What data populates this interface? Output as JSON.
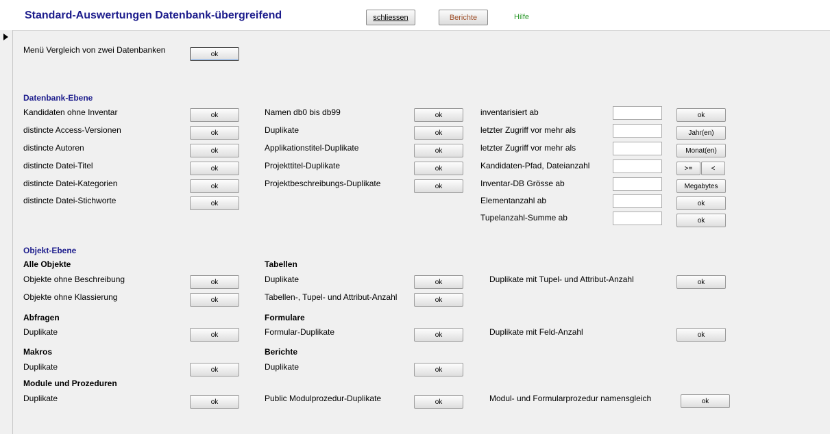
{
  "header": {
    "title": "Standard-Auswertungen Datenbank-übergreifend",
    "close_label": "schliessen",
    "reports_label": "Berichte",
    "help_label": "Hilfe",
    "help_color": "#2e9a2e",
    "reports_color": "#a0522d",
    "title_color": "#1c1c8c"
  },
  "menu_compare": {
    "label": "Menü Vergleich von zwei Datenbanken",
    "button": "ok"
  },
  "db_level": {
    "heading": "Datenbank-Ebene",
    "col1": [
      {
        "label": "Kandidaten ohne Inventar",
        "button": "ok"
      },
      {
        "label": "distincte Access-Versionen",
        "button": "ok"
      },
      {
        "label": "distincte Autoren",
        "button": "ok"
      },
      {
        "label": "distincte Datei-Titel",
        "button": "ok"
      },
      {
        "label": "distincte Datei-Kategorien",
        "button": "ok"
      },
      {
        "label": "distincte Datei-Stichworte",
        "button": "ok"
      }
    ],
    "col2": [
      {
        "label": "Namen db0 bis db99",
        "button": "ok"
      },
      {
        "label": "Duplikate",
        "button": "ok"
      },
      {
        "label": "Applikationstitel-Duplikate",
        "button": "ok"
      },
      {
        "label": "Projekttitel-Duplikate",
        "button": "ok"
      },
      {
        "label": "Projektbeschreibungs-Duplikate",
        "button": "ok"
      }
    ],
    "col3": [
      {
        "label": "inventarisiert ab",
        "value": "",
        "button": "ok"
      },
      {
        "label": "letzter Zugriff vor mehr als",
        "value": "",
        "button": "Jahr(en)"
      },
      {
        "label": "letzter Zugriff vor mehr als",
        "value": "",
        "button": "Monat(en)"
      },
      {
        "label": "Kandidaten-Pfad, Dateianzahl",
        "value": "",
        "button_ge": ">=",
        "button_lt": "<"
      },
      {
        "label": "Inventar-DB Grösse ab",
        "value": "",
        "button": "Megabytes"
      },
      {
        "label": "Elementanzahl ab",
        "value": "",
        "button": "ok"
      },
      {
        "label": "Tupelanzahl-Summe ab",
        "value": "",
        "button": "ok"
      }
    ]
  },
  "obj_level": {
    "heading": "Objekt-Ebene",
    "all_objects": {
      "heading": "Alle Objekte",
      "items": [
        {
          "label": "Objekte ohne Beschreibung",
          "button": "ok"
        },
        {
          "label": "Objekte ohne Klassierung",
          "button": "ok"
        }
      ]
    },
    "tables": {
      "heading": "Tabellen",
      "items": [
        {
          "label": "Duplikate",
          "button": "ok"
        },
        {
          "label": "Tabellen-, Tupel- und Attribut-Anzahl",
          "button": "ok"
        }
      ],
      "extra": {
        "label": "Duplikate mit Tupel- und Attribut-Anzahl",
        "button": "ok"
      }
    },
    "queries": {
      "heading": "Abfragen",
      "item": {
        "label": "Duplikate",
        "button": "ok"
      }
    },
    "forms": {
      "heading": "Formulare",
      "item": {
        "label": "Formular-Duplikate",
        "button": "ok"
      },
      "extra": {
        "label": "Duplikate mit Feld-Anzahl",
        "button": "ok"
      }
    },
    "macros": {
      "heading": "Makros",
      "item": {
        "label": "Duplikate",
        "button": "ok"
      }
    },
    "reports": {
      "heading": "Berichte",
      "item": {
        "label": "Duplikate",
        "button": "ok"
      }
    },
    "modules": {
      "heading": "Module und Prozeduren",
      "item": {
        "label": "Duplikate",
        "button": "ok"
      },
      "public": {
        "label": "Public Modulprozedur-Duplikate",
        "button": "ok"
      },
      "same_name": {
        "label": "Modul- und Formularprozedur namensgleich",
        "button": "ok"
      }
    }
  }
}
